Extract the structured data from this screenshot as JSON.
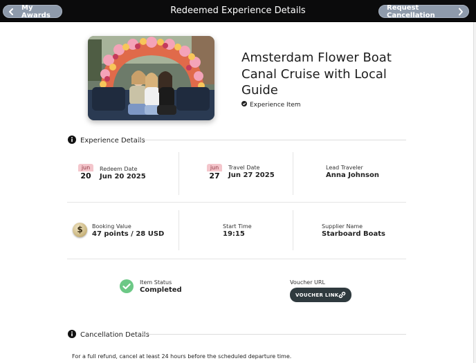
{
  "header": {
    "title": "Redeemed Experience Details",
    "back_label": "My Awards",
    "cancel_label": "Request Cancellation"
  },
  "hero": {
    "title_lines": [
      "Amsterdam Flower Boat",
      "Canal Cruise with Local",
      "Guide"
    ],
    "item_type": "Experience Item"
  },
  "experience_details": {
    "heading": "Experience Details",
    "redeem": {
      "month": "jun",
      "day": "20",
      "label": "Redeem Date",
      "value": "Jun 20 2025"
    },
    "travel": {
      "month": "jun",
      "day": "27",
      "label": "Travel Date",
      "value": "Jun 27 2025"
    },
    "lead": {
      "label": "Lead Traveler",
      "value": "Anna Johnson"
    },
    "booking": {
      "label": "Booking Value",
      "value": "47 points / 28 USD",
      "icon_text": "$"
    },
    "start": {
      "label": "Start Time",
      "value": "19:15"
    },
    "supplier": {
      "label": "Supplier Name",
      "value": "Starboard Boats"
    },
    "status": {
      "label": "Item Status",
      "value": "Completed"
    },
    "voucher": {
      "label": "Voucher URL",
      "button": "VOUCHER LINK"
    }
  },
  "cancellation": {
    "heading": "Cancellation Details",
    "note": "For a full refund, cancel at least 24 hours before the scheduled departure time."
  },
  "colors": {
    "topbar": "#0b0b0c",
    "pill": "#8e9aab",
    "status_green": "#6cc886",
    "calendar_pink": "#f4c6cc",
    "voucher_dark": "#2f3a3e"
  }
}
